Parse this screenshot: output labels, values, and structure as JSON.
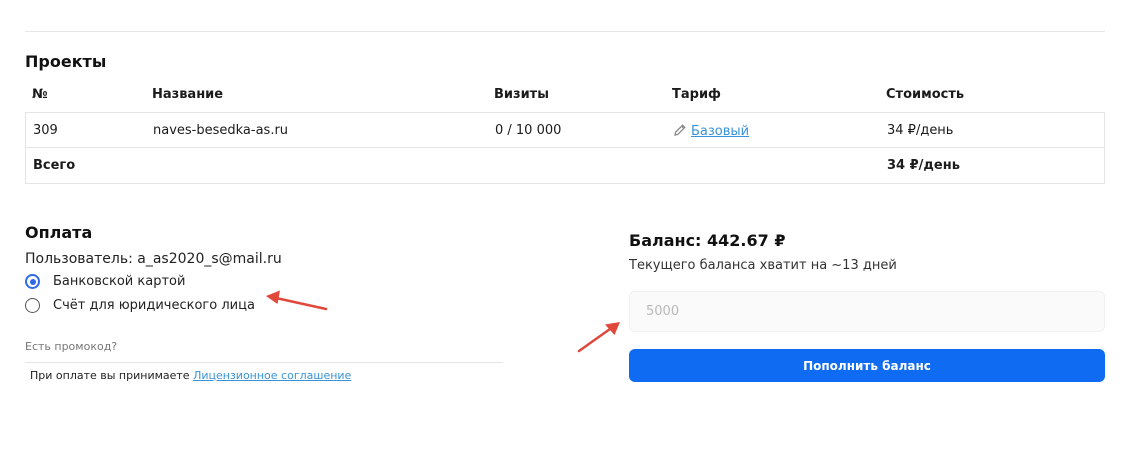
{
  "projects": {
    "title": "Проекты",
    "columns": [
      "№",
      "Название",
      "Визиты",
      "Тариф",
      "Стоимость"
    ],
    "rows": [
      {
        "id": "309",
        "name": "naves-besedka-as.ru",
        "visits": "0 / 10 000",
        "tariff": "Базовый",
        "cost": "34 ₽/день"
      }
    ],
    "total": {
      "label": "Всего",
      "cost": "34 ₽/день"
    }
  },
  "payment": {
    "title": "Оплата",
    "user": "Пользователь: a_as2020_s@mail.ru",
    "methods": [
      {
        "label": "Банковской картой",
        "selected": true
      },
      {
        "label": "Счёт для юридического лица",
        "selected": false
      }
    ],
    "promo": "Есть промокод?",
    "license_prefix": "При оплате вы принимаете",
    "license_link": "Лицензионное соглашение"
  },
  "balance": {
    "title": "Баланс: 442.67 ₽",
    "subtitle": "Текущего баланса хватит на ~13 дней",
    "amount_placeholder": "5000",
    "topup_label": "Пополнить баланс"
  },
  "colors": {
    "accent": "#0f6cf2",
    "link": "#3a93d8",
    "annotation_arrow": "#e0483c"
  },
  "icons": {
    "tariff_edit": "pencil-icon"
  }
}
